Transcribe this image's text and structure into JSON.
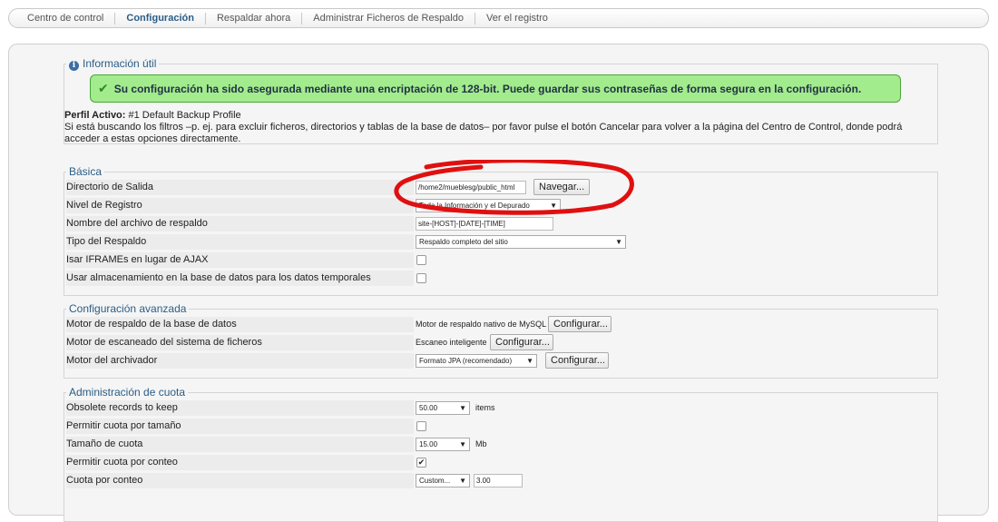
{
  "nav": {
    "items": [
      "Centro de control",
      "Configuración",
      "Respaldar ahora",
      "Administrar Ficheros de Respaldo",
      "Ver el registro"
    ],
    "active_index": 1
  },
  "info": {
    "legend": "Información útil",
    "success_message": "Su configuración ha sido asegurada mediante una encriptación de 128-bit. Puede guardar sus contraseñas de forma segura en la configuración.",
    "profile_label": "Perfil Activo:",
    "profile_value": "#1 Default Backup Profile",
    "help_text": "Si está buscando los filtros –p. ej. para excluir ficheros, directorios y tablas de la base de datos– por favor pulse el botón Cancelar para volver a la página del Centro de Control, donde podrá acceder a estas opciones directamente."
  },
  "basic": {
    "legend": "Básica",
    "output_dir_label": "Directorio de Salida",
    "output_dir_value": "/home2/mueblesg/public_html",
    "browse_button": "Navegar...",
    "log_level_label": "Nivel de Registro",
    "log_level_value": "Toda la Información y el Depurado",
    "archive_name_label": "Nombre del archivo de respaldo",
    "archive_name_value": "site-[HOST]-[DATE]-[TIME]",
    "backup_type_label": "Tipo del Respaldo",
    "backup_type_value": "Respaldo completo del sitio",
    "iframes_label": "Isar IFRAMEs en lugar de AJAX",
    "iframes_checked": false,
    "db_temp_label": "Usar almacenamiento en la base de datos para los datos temporales",
    "db_temp_checked": false
  },
  "advanced": {
    "legend": "Configuración avanzada",
    "db_engine_label": "Motor de respaldo de la base de datos",
    "db_engine_value": "Motor de respaldo nativo de MySQL",
    "fs_scan_label": "Motor de escaneado del sistema de ficheros",
    "fs_scan_value": "Escaneo inteligente",
    "archiver_label": "Motor del archivador",
    "archiver_value": "Formato JPA (recomendado)",
    "configure_button": "Configurar..."
  },
  "quota": {
    "legend": "Administración de cuota",
    "obsolete_label": "Obsolete records to keep",
    "obsolete_value": "50.00",
    "obsolete_unit": "items",
    "size_quota_enable_label": "Permitir cuota por tamaño",
    "size_quota_enable_checked": false,
    "size_quota_label": "Tamaño de cuota",
    "size_quota_value": "15.00",
    "size_quota_unit": "Mb",
    "count_quota_enable_label": "Permitir cuota por conteo",
    "count_quota_enable_checked": true,
    "count_quota_label": "Cuota por conteo",
    "count_quota_select": "Custom...",
    "count_quota_value": "3.00"
  },
  "annotation_color": "#e01010"
}
